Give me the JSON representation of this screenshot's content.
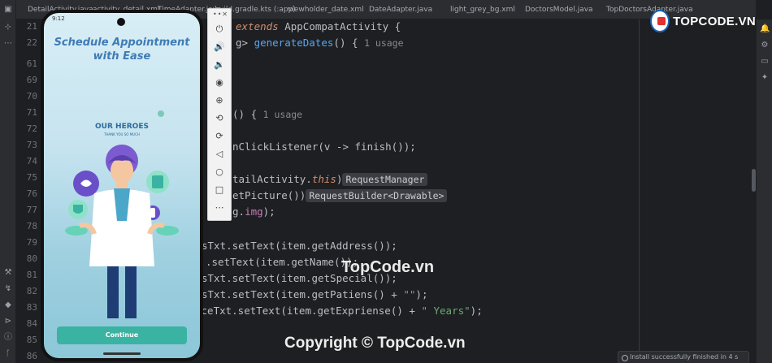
{
  "tabs": [
    {
      "label": "DetailActivity.java",
      "icon": "java"
    },
    {
      "label": "activity_detail.xml",
      "icon": "xml"
    },
    {
      "label": "TimeAdapter.java",
      "icon": "java"
    },
    {
      "label": "build.gradle.kts (:app)",
      "icon": "kts"
    },
    {
      "label": "viewholder_date.xml",
      "icon": "xml"
    },
    {
      "label": "DateAdapter.java",
      "icon": "java"
    },
    {
      "label": "light_grey_bg.xml",
      "icon": "xml"
    },
    {
      "label": "DoctorsModel.java",
      "icon": "java"
    },
    {
      "label": "TopDoctorsAdapter.java",
      "icon": "java"
    }
  ],
  "gutter": [
    "21",
    "22",
    "61",
    "69",
    "70",
    "71",
    "72",
    "73",
    "74",
    "75",
    "76",
    "77",
    "78",
    "79",
    "80",
    "81",
    "82",
    "83",
    "84",
    "85",
    "86"
  ],
  "code": {
    "l1_kw": "extends",
    "l1_rest": " AppCompatActivity {",
    "l2_pre": "g> ",
    "l2_fn": "generateDates",
    "l2_post": "() {",
    "l2_hint": "1 usage",
    "l6_pre": "() {",
    "l6_hint": "1 usage",
    "l8": "nClickListener(v -> finish());",
    "l10_a": "tailActivity.",
    "l10_b": "this",
    "l10_c": ")",
    "l10_inlay": "RequestManager",
    "l11_a": "etPicture())",
    "l11_inlay": "RequestBuilder<Drawable>",
    "l12_a": "g.",
    "l12_b": "img",
    "l12_c": ");",
    "l14": "sTxt.setText(item.getAddress());",
    "l15": ".setText(item.getName());",
    "l16": "sTxt.setText(item.getSpecial());",
    "l17_a": "sTxt.setText(item.getPatiens() + ",
    "l17_str": "\"\"",
    "l17_c": ");",
    "l18_a": "nceTxt.setText(item.getExpriense() + ",
    "l18_str": "\" Years\"",
    "l18_c": ");"
  },
  "phone": {
    "status_time": "9:12",
    "title": "Schedule Appointment with Ease",
    "heroes": "OUR HEROES",
    "heroes_sub": "THANK YOU SO MUCH",
    "continue_label": "Continue"
  },
  "emulator_tools": [
    "power-icon",
    "volume-up-icon",
    "volume-down-icon",
    "camera-icon",
    "zoom-icon",
    "rotate-left-icon",
    "rotate-right-icon",
    "back-icon",
    "home-icon",
    "overview-icon",
    "more-icon"
  ],
  "logo": {
    "text": "TOPCODE.VN"
  },
  "watermarks": {
    "center": "TopCode.vn",
    "bottom": "Copyright © TopCode.vn"
  },
  "toast": "Install successfully finished in 4 s",
  "colors": {
    "editor_bg": "#1e1f22",
    "keyword": "#cf8e6d",
    "function": "#56a8f5",
    "field": "#c77dbb",
    "string": "#6aab73",
    "button": "#3bb3a2"
  }
}
